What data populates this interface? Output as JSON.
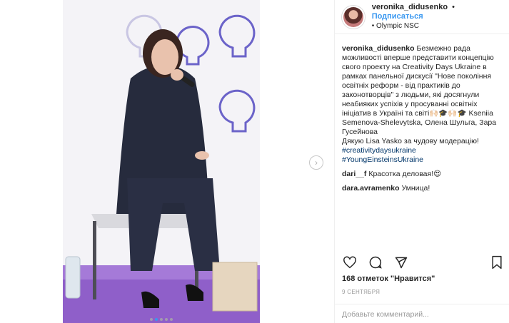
{
  "post": {
    "username": "veronika_didusenko",
    "follow_label": "Подписаться",
    "location": "Olympic NSC",
    "caption_user": "veronika_didusenko",
    "caption_text": " Безмежно рада можливості вперше представити концепцію свого проекту на Creativity Days Ukraine в рамках панельної дискусії \"Нове покоління освітніх реформ - від практиків до законотворців\" з людьми, які досягнули неабияких успіхів у просуванні освітніх ініціатив в Україні та світі🙌🏻🎓🙌🏻🎓 Kseniia Semenova-Shelevytska, Олена Шульга, Зара Гусейнова\nДякую Lisa Yasko за чудову модерацію!",
    "hashtags": [
      "#creativitydaysukraine",
      "#YoungEinsteinsUkraine"
    ],
    "comments": [
      {
        "user": "dari__f",
        "text": " Красотка деловая!😍"
      },
      {
        "user": "dara.avramenko",
        "text": " Умница!"
      }
    ],
    "likes_text": "168 отметок \"Нравится\"",
    "date": "9 СЕНТЯБРЯ",
    "add_comment_placeholder": "Добавьте комментарий...",
    "carousel": {
      "count": 5,
      "active_index": 1
    },
    "icons": {
      "like": "heart-icon",
      "comment": "comment-icon",
      "share": "share-icon",
      "save": "bookmark-icon",
      "next": "chevron-right-icon"
    },
    "colors": {
      "link": "#3897f0",
      "hashtag": "#003569",
      "muted": "#999999",
      "active_dot": "#3897f0"
    }
  }
}
